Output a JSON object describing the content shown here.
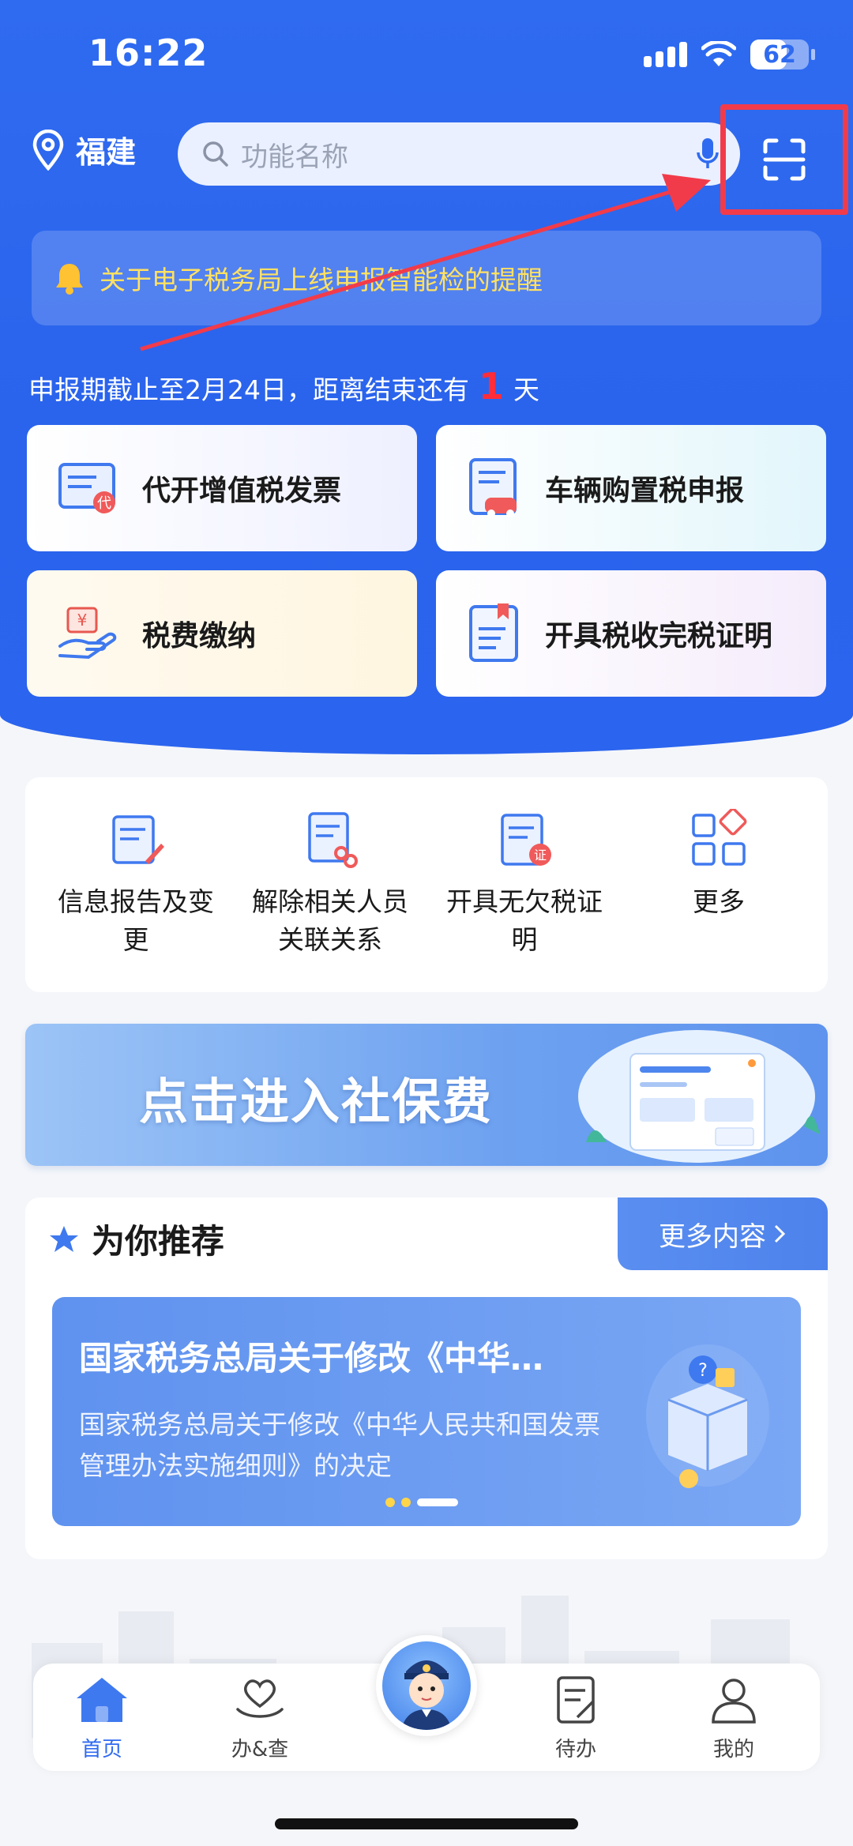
{
  "status_bar": {
    "time": "16:22",
    "battery": "62"
  },
  "topbar": {
    "location": "福建",
    "search_placeholder": "功能名称"
  },
  "notice": {
    "text": "关于电子税务局上线申报智能检的提醒"
  },
  "deadline": {
    "prefix": "申报期截止至2月24日，距离结束还有",
    "days": "1",
    "suffix": "天"
  },
  "main_cards": [
    {
      "label": "代开增值税发票",
      "icon": "invoice-icon"
    },
    {
      "label": "车辆购置税申报",
      "icon": "vehicle-tax-icon"
    },
    {
      "label": "税费缴纳",
      "icon": "tax-payment-icon"
    },
    {
      "label": "开具税收完税证明",
      "icon": "tax-certificate-icon"
    }
  ],
  "quick_grid": [
    {
      "label": "信息报告及变更",
      "icon": "info-report-icon"
    },
    {
      "label": "解除相关人员关联关系",
      "icon": "unlink-icon"
    },
    {
      "label": "开具无欠税证明",
      "icon": "no-arrears-icon"
    },
    {
      "label": "更多",
      "icon": "more-grid-icon"
    }
  ],
  "banner": {
    "text": "点击进入社保费"
  },
  "recommend": {
    "title": "为你推荐",
    "more": "更多内容",
    "card_title": "国家税务总局关于修改《中华…",
    "card_body": "国家税务总局关于修改《中华人民共和国发票管理办法实施细则》的决定"
  },
  "tabs": [
    {
      "label": "首页",
      "active": true
    },
    {
      "label": "办&查",
      "active": false
    },
    {
      "label": "待办",
      "active": false
    },
    {
      "label": "我的",
      "active": false
    }
  ],
  "colors": {
    "brand": "#2f6bf0",
    "highlight": "#f23b4a",
    "notice": "#ffe162"
  }
}
